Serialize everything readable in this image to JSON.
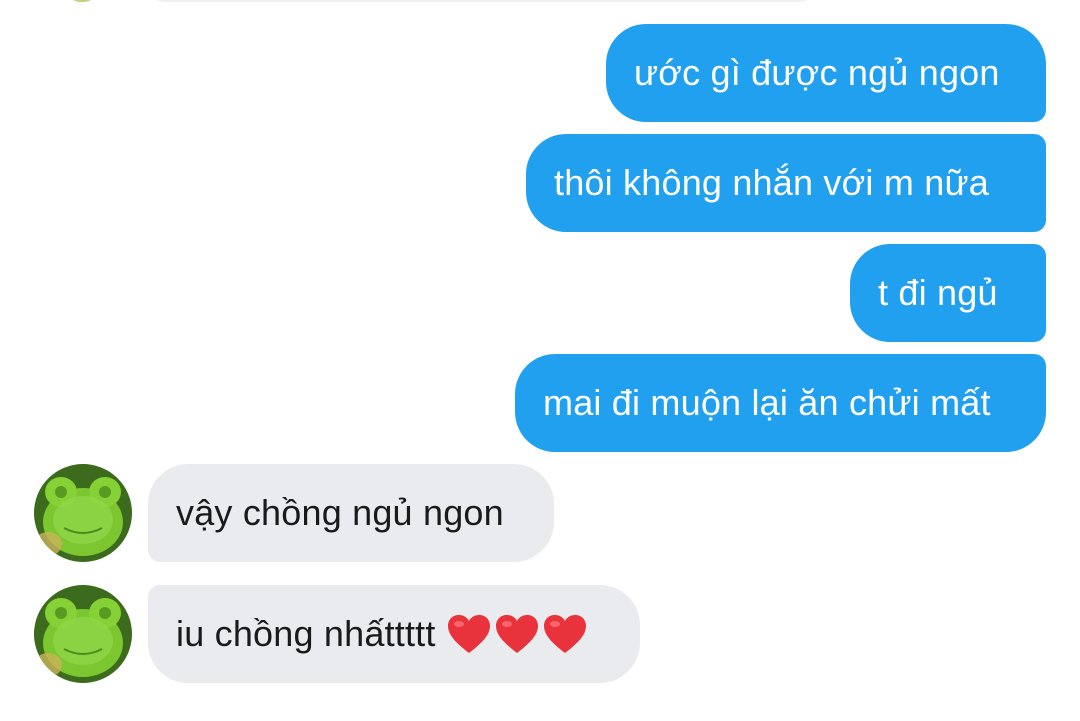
{
  "conversation": {
    "sent_messages": [
      {
        "text": "ước gì được ngủ ngon"
      },
      {
        "text": "thôi không nhắn với m nữa"
      },
      {
        "text": "t đi ngủ"
      },
      {
        "text": "mai đi muộn lại ăn chửi mất"
      }
    ],
    "received_messages": [
      {
        "text": "vậy chồng ngủ ngon"
      },
      {
        "text": "iu chồng nhấttttt"
      }
    ]
  },
  "colors": {
    "sent_bubble": "#21a0f0",
    "received_bubble": "#e9ebef",
    "heart": "#e8323c"
  },
  "icons": {
    "avatar": "green-frog-plush-avatar",
    "heart": "red-heart-emoji"
  }
}
